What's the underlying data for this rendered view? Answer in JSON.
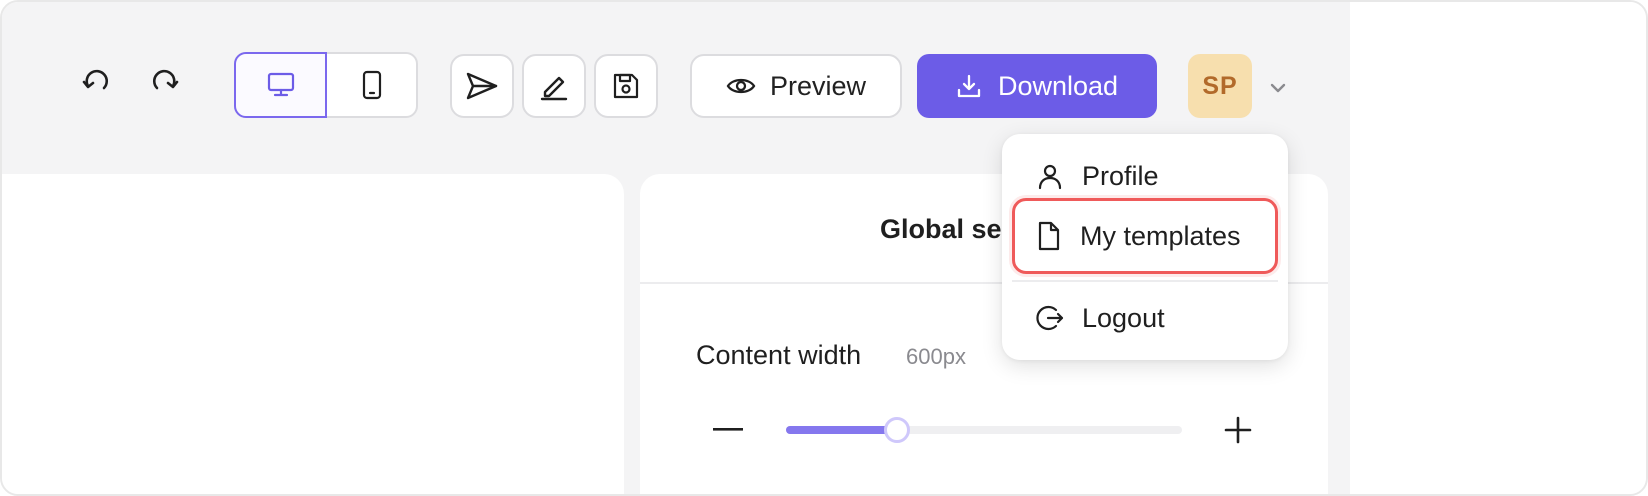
{
  "toolbar": {
    "undo_icon": "undo-icon",
    "redo_icon": "redo-icon",
    "device": {
      "desktop_icon": "desktop-icon",
      "mobile_icon": "mobile-icon",
      "selected": "desktop"
    },
    "send_icon": "send-icon",
    "edit_icon": "pen-icon",
    "save_icon": "save-icon",
    "preview_label": "Preview",
    "download_label": "Download",
    "accent_color": "#6c5ce7"
  },
  "user": {
    "initials": "SP",
    "avatar_color": "#f7dfae"
  },
  "menu": {
    "items": [
      {
        "label": "Profile",
        "icon": "user-icon"
      },
      {
        "label": "My templates",
        "icon": "document-icon",
        "highlighted": true
      },
      {
        "label": "Logout",
        "icon": "logout-icon"
      }
    ],
    "highlight_color": "#ef5a5a"
  },
  "settings": {
    "title": "Global se",
    "content_width_label": "Content width",
    "content_width_value": "600px",
    "slider_fraction": 0.28
  }
}
